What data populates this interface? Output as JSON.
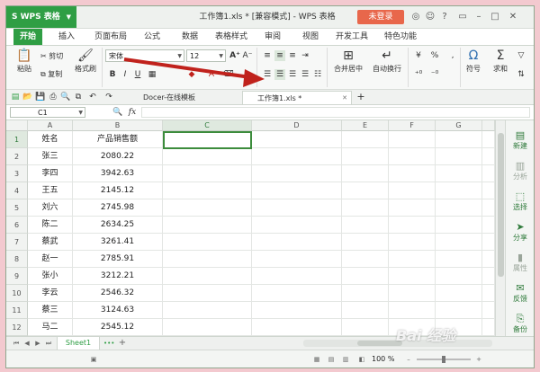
{
  "app": {
    "name": "WPS 表格",
    "window_title": "工作簿1.xls * [兼容模式] - WPS 表格",
    "login_label": "未登录"
  },
  "tabs": [
    "开始",
    "插入",
    "页面布局",
    "公式",
    "数据",
    "表格样式",
    "审阅",
    "视图",
    "开发工具",
    "特色功能"
  ],
  "ribbon": {
    "paste_label": "粘贴",
    "cut_label": "剪切",
    "copy_label": "复制",
    "format_painter_label": "格式刷",
    "font_name": "宋体",
    "font_size": "12",
    "merge_center_label": "合并居中",
    "wrap_text_label": "自动换行",
    "symbol_label": "符号",
    "sum_label": "求和",
    "percent_glyph": "%"
  },
  "doc_tabs": [
    "Docer-在线模板",
    "工作簿1.xls *"
  ],
  "formula_bar": {
    "name_box": "C1",
    "fx_label": "fx"
  },
  "columns": [
    "A",
    "B",
    "C",
    "D",
    "E",
    "F",
    "G"
  ],
  "rows": [
    {
      "num": "1",
      "a": "姓名",
      "b": "产品销售额"
    },
    {
      "num": "2",
      "a": "张三",
      "b": "2080.22"
    },
    {
      "num": "3",
      "a": "李四",
      "b": "3942.63"
    },
    {
      "num": "4",
      "a": "王五",
      "b": "2145.12"
    },
    {
      "num": "5",
      "a": "刘六",
      "b": "2745.98"
    },
    {
      "num": "6",
      "a": "陈二",
      "b": "2634.25"
    },
    {
      "num": "7",
      "a": "蔡武",
      "b": "3261.41"
    },
    {
      "num": "8",
      "a": "赵一",
      "b": "2785.91"
    },
    {
      "num": "9",
      "a": "张小",
      "b": "3212.21"
    },
    {
      "num": "10",
      "a": "李云",
      "b": "2546.32"
    },
    {
      "num": "11",
      "a": "蔡三",
      "b": "3124.63"
    },
    {
      "num": "12",
      "a": "马二",
      "b": "2545.12"
    }
  ],
  "right_panel": [
    "新建",
    "分析",
    "选择",
    "分享",
    "属性",
    "反馈",
    "备份"
  ],
  "sheet_tab": "Sheet1",
  "status": {
    "zoom": "100 %"
  },
  "watermark": "Bai 经验",
  "colors": {
    "brand_green": "#2f9e44",
    "login_orange": "#e8674b",
    "arrow_red": "#c0221c",
    "background_pink": "#f3c9cf"
  }
}
